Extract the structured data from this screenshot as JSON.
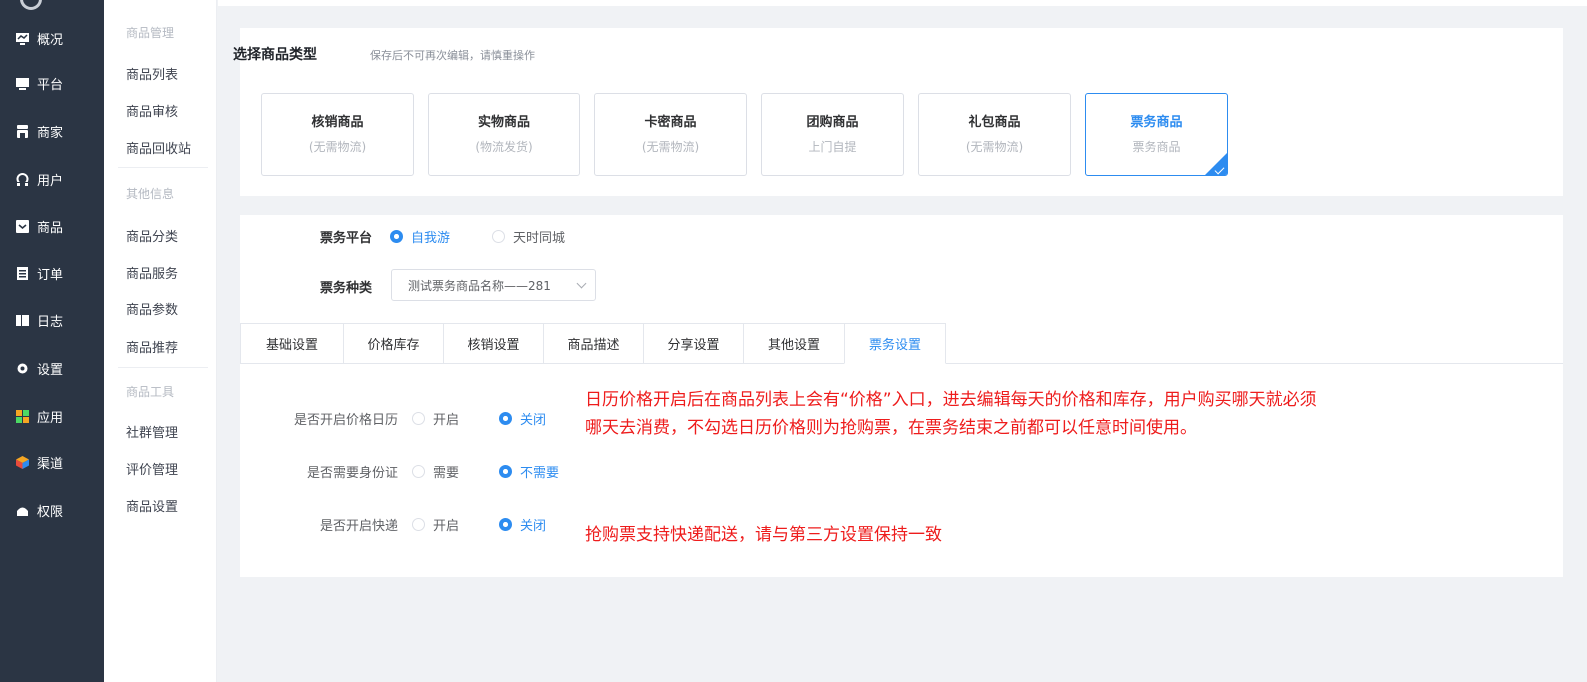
{
  "nav": {
    "items": [
      {
        "label": "概况",
        "icon": "chart-icon"
      },
      {
        "label": "平台",
        "icon": "monitor-icon"
      },
      {
        "label": "商家",
        "icon": "store-icon"
      },
      {
        "label": "用户",
        "icon": "user-icon"
      },
      {
        "label": "商品",
        "icon": "goods-icon"
      },
      {
        "label": "订单",
        "icon": "order-icon"
      },
      {
        "label": "日志",
        "icon": "log-icon"
      },
      {
        "label": "设置",
        "icon": "gear-icon"
      },
      {
        "label": "应用",
        "icon": "apps-icon"
      },
      {
        "label": "渠道",
        "icon": "cube-icon"
      },
      {
        "label": "权限",
        "icon": "lock-icon"
      }
    ]
  },
  "submenu": {
    "group1": "商品管理",
    "item1": "商品列表",
    "item2": "商品审核",
    "item3": "商品回收站",
    "group2": "其他信息",
    "item4": "商品分类",
    "item5": "商品服务",
    "item6": "商品参数",
    "item7": "商品推荐",
    "group3": "商品工具",
    "item8": "社群管理",
    "item9": "评价管理",
    "item10": "商品设置"
  },
  "type_section": {
    "title": "选择商品类型",
    "note": "保存后不可再次编辑，请慎重操作",
    "types": [
      {
        "name": "核销商品",
        "sub": "(无需物流)"
      },
      {
        "name": "实物商品",
        "sub": "(物流发货)"
      },
      {
        "name": "卡密商品",
        "sub": "(无需物流)"
      },
      {
        "name": "团购商品",
        "sub": "上门自提"
      },
      {
        "name": "礼包商品",
        "sub": "(无需物流)"
      },
      {
        "name": "票务商品",
        "sub": "票务商品"
      }
    ],
    "selected": "票务商品"
  },
  "ticket": {
    "platform_label": "票务平台",
    "platform_options": [
      "自我游",
      "天时同城"
    ],
    "platform_selected": "自我游",
    "kind_label": "票务种类",
    "kind_value": "测试票务商品名称——281"
  },
  "tabs": [
    "基础设置",
    "价格库存",
    "核销设置",
    "商品描述",
    "分享设置",
    "其他设置",
    "票务设置"
  ],
  "active_tab": "票务设置",
  "settings": {
    "calendar": {
      "label": "是否开启价格日历",
      "on": "开启",
      "off": "关闭",
      "selected": "关闭"
    },
    "idcard": {
      "label": "是否需要身份证",
      "on": "需要",
      "off": "不需要",
      "selected": "不需要"
    },
    "express": {
      "label": "是否开启快递",
      "on": "开启",
      "off": "关闭",
      "selected": "关闭"
    }
  },
  "notes": {
    "calendar_line1": "日历价格开启后在商品列表上会有“价格”入口，进去编辑每天的价格和库存，用户购买哪天就必须",
    "calendar_line2": "哪天去消费，不勾选日历价格则为抢购票，在票务结束之前都可以任意时间使用。",
    "express": "抢购票支持快递配送，请与第三方设置保持一致"
  },
  "colors": {
    "primary": "#2d8cf0",
    "sidebar": "#2b3544",
    "annotation": "#ee1c1c"
  }
}
